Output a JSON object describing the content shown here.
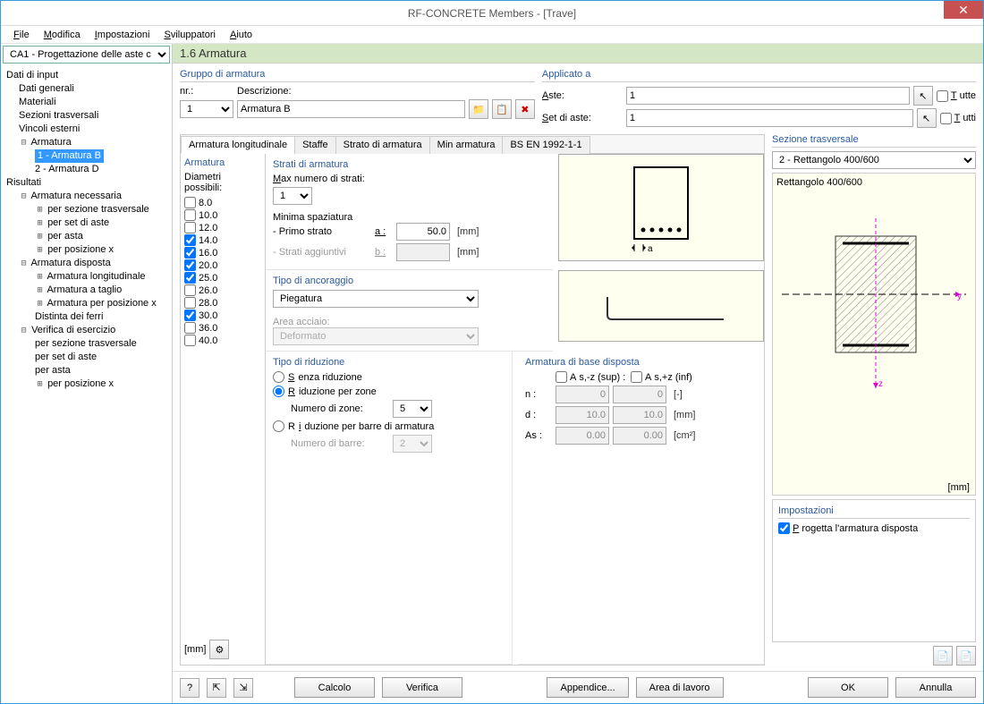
{
  "window_title": "RF-CONCRETE Members - [Trave]",
  "menu": [
    "File",
    "Modifica",
    "Impostazioni",
    "Sviluppatori",
    "Aiuto"
  ],
  "case_selector": "CA1 - Progettazione delle aste c",
  "page_title": "1.6 Armatura",
  "tree": {
    "root1": "Dati di input",
    "dati_generali": "Dati generali",
    "materiali": "Materiali",
    "sezioni": "Sezioni trasversali",
    "vincoli": "Vincoli esterni",
    "armatura": "Armatura",
    "armatura_b": "1 - Armatura B",
    "armatura_d": "2 - Armatura D",
    "risultati": "Risultati",
    "arm_nec": "Armatura necessaria",
    "per_sez": "per sezione trasversale",
    "per_set": "per set di aste",
    "per_asta": "per asta",
    "per_pos": "per posizione x",
    "arm_disp": "Armatura disposta",
    "arm_long": "Armatura longitudinale",
    "arm_taglio": "Armatura a taglio",
    "arm_posx": "Armatura per posizione x",
    "distinta": "Distinta dei ferri",
    "ver_eser": "Verifica di esercizio",
    "ver_sez": "per sezione trasversale",
    "ver_set": "per set di aste",
    "ver_asta": "per asta",
    "ver_pos": "per posizione x"
  },
  "gruppo": {
    "title": "Gruppo di armatura",
    "nr_lbl": "nr.:",
    "nr": "1",
    "desc_lbl": "Descrizione:",
    "desc": "Armatura B"
  },
  "applicato": {
    "title": "Applicato a",
    "aste_lbl": "Aste:",
    "aste": "1",
    "set_lbl": "Set di aste:",
    "set": "1",
    "tutte": "Tutte",
    "tutti": "Tutti"
  },
  "tabs": [
    "Armatura longitudinale",
    "Staffe",
    "Strato di armatura",
    "Min armatura",
    "BS EN 1992-1-1"
  ],
  "armatura_col": {
    "title": "Armatura",
    "diam_lbl": "Diametri possibili:",
    "diams": [
      "8.0",
      "10.0",
      "12.0",
      "14.0",
      "16.0",
      "20.0",
      "25.0",
      "26.0",
      "28.0",
      "30.0",
      "36.0",
      "40.0"
    ],
    "checked": [
      false,
      false,
      false,
      true,
      true,
      true,
      true,
      false,
      false,
      true,
      false,
      false
    ],
    "unit": "[mm]"
  },
  "strati": {
    "title": "Strati di armatura",
    "max_lbl": "Max numero di strati:",
    "max": "1",
    "min_spaz": "Minima spaziatura",
    "primo": "- Primo strato",
    "primo_sym": "a :",
    "primo_val": "50.0",
    "agg": "- Strati aggiuntivi",
    "agg_sym": "b :",
    "unit": "[mm]"
  },
  "ancoraggio": {
    "title": "Tipo di ancoraggio",
    "val": "Piegatura",
    "area_lbl": "Area acciaio:",
    "area_val": "Deformato"
  },
  "riduzione": {
    "title": "Tipo di riduzione",
    "senza": "Senza riduzione",
    "zone": "Riduzione per zone",
    "num_zone_lbl": "Numero di zone:",
    "num_zone": "5",
    "barre": "Riduzione per barre di armatura",
    "num_barre_lbl": "Numero di barre:",
    "num_barre": "2"
  },
  "base": {
    "title": "Armatura di base disposta",
    "as_sup": "As,-z (sup):",
    "as_inf": "As,+z (inf)",
    "n_lbl": "n :",
    "n1": "0",
    "n2": "0",
    "n_unit": "[-]",
    "d_lbl": "d :",
    "d1": "10.0",
    "d2": "10.0",
    "d_unit": "[mm]",
    "as_lbl": "As :",
    "as1": "0.00",
    "as2": "0.00",
    "as_unit": "[cm²]"
  },
  "sezione": {
    "title": "Sezione trasversale",
    "sel": "2 - Rettangolo 400/600",
    "caption": "Rettangolo 400/600",
    "unit": "[mm]"
  },
  "impostazioni": {
    "title": "Impostazioni",
    "chk": "Progetta l'armatura disposta"
  },
  "footer": {
    "calcolo": "Calcolo",
    "verifica": "Verifica",
    "appendice": "Appendice...",
    "area": "Area di lavoro",
    "ok": "OK",
    "annulla": "Annulla"
  }
}
